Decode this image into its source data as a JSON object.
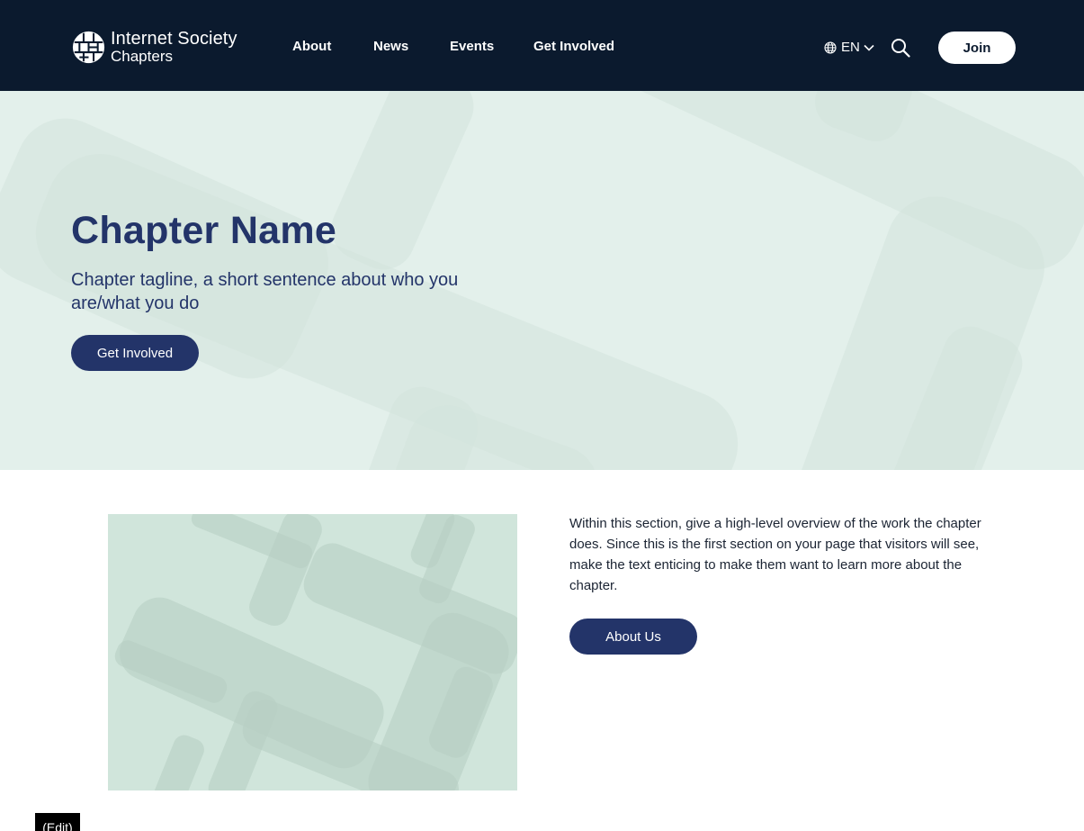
{
  "header": {
    "logo": {
      "line1": "Internet Society",
      "line2": "Chapters",
      "icon": "globe-logo-icon"
    },
    "nav": [
      {
        "label": "About"
      },
      {
        "label": "News"
      },
      {
        "label": "Events"
      },
      {
        "label": "Get Involved"
      }
    ],
    "language": {
      "label": "EN",
      "icon": "globe-icon",
      "chevron": "chevron-down-icon"
    },
    "search": {
      "icon": "search-icon"
    },
    "join_label": "Join"
  },
  "hero": {
    "title": "Chapter Name",
    "tagline": "Chapter tagline, a short sentence about who you are/what you do",
    "cta_label": "Get Involved"
  },
  "intro": {
    "body": "Within this section, give a high-level overview of the work the chapter does. Since this is the first section on your page that visitors will see, make the text enticing to make them want to learn more about the chapter.",
    "button_label": "About Us"
  },
  "edit_label": "(Edit)",
  "colors": {
    "header_bg": "#0b1a2e",
    "brand_navy": "#233469",
    "hero_bg": "#e3f0eb",
    "image_placeholder_bg": "#d0e5db"
  }
}
